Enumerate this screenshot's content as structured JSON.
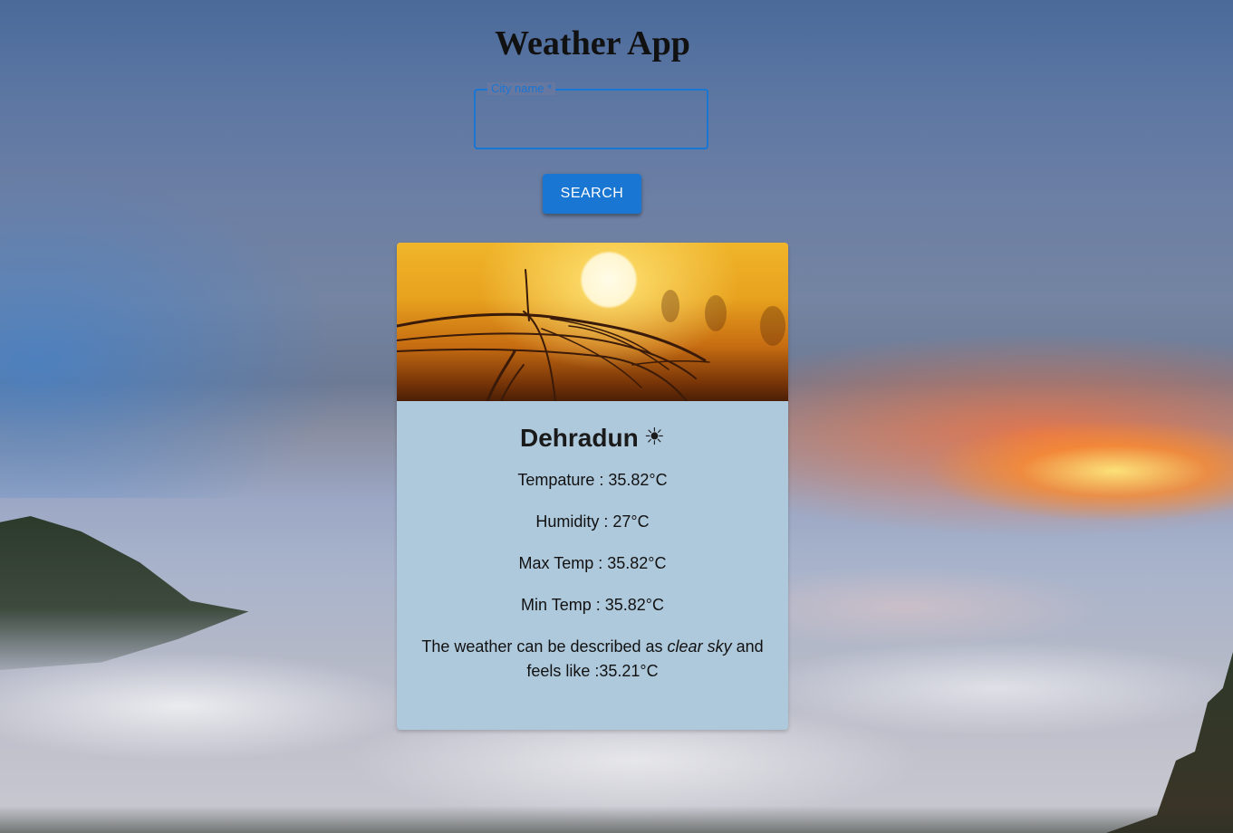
{
  "app": {
    "title": "Weather App"
  },
  "search": {
    "label": "City name *",
    "value": "",
    "button_label": "SEARCH"
  },
  "card": {
    "city": "Dehradun",
    "weather_icon": "sun-icon",
    "weather_icon_glyph": "☀",
    "temperature": "Tempature : 35.82°C",
    "humidity": "Humidity : 27°C",
    "max_temp": "Max Temp : 35.82°C",
    "min_temp": "Min Temp : 35.82°C",
    "description_prefix": "The weather can be described as",
    "description_value": "clear sky",
    "description_suffix": "and feels like :35.21°C"
  },
  "colors": {
    "accent": "#1976d2",
    "card_background": "#afc9dc"
  }
}
